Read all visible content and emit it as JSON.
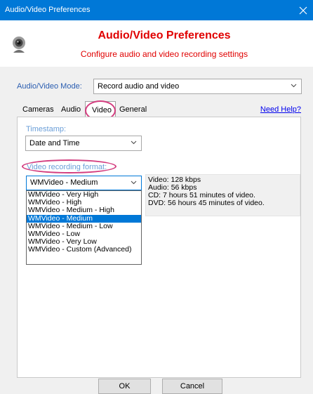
{
  "window": {
    "title": "Audio/Video Preferences",
    "close_glyph": "✕"
  },
  "header": {
    "title": "Audio/Video Preferences",
    "subtitle": "Configure audio and video recording settings",
    "icon": "webcam-icon"
  },
  "mode": {
    "label": "Audio/Video Mode:",
    "value": "Record audio and video"
  },
  "tabs": [
    {
      "label": "Cameras"
    },
    {
      "label": "Audio"
    },
    {
      "label": "Video",
      "active": true
    },
    {
      "label": "General"
    }
  ],
  "help_link": "Need Help?",
  "timestamp": {
    "label": "Timestamp:",
    "value": "Date and Time"
  },
  "format": {
    "label": "Video recording format:",
    "value": "WMVideo - Medium",
    "options": [
      "WMVideo - Very High",
      "WMVideo - High",
      "WMVideo - Medium - High",
      "WMVideo - Medium",
      "WMVideo - Medium - Low",
      "WMVideo - Low",
      "WMVideo - Very Low",
      "WMVideo - Custom (Advanced)"
    ],
    "selected_index": 3
  },
  "info": [
    "Video: 128 kbps",
    "Audio: 56 kbps",
    "CD: 7 hours 51 minutes of video.",
    "DVD: 56 hours 45 minutes of video."
  ],
  "buttons": {
    "ok": "OK",
    "cancel": "Cancel"
  },
  "colors": {
    "titlebar": "#0078d7",
    "accent_red": "#e00000",
    "highlight_ring": "#d33d7f",
    "label_blue": "#6a9ed8"
  }
}
